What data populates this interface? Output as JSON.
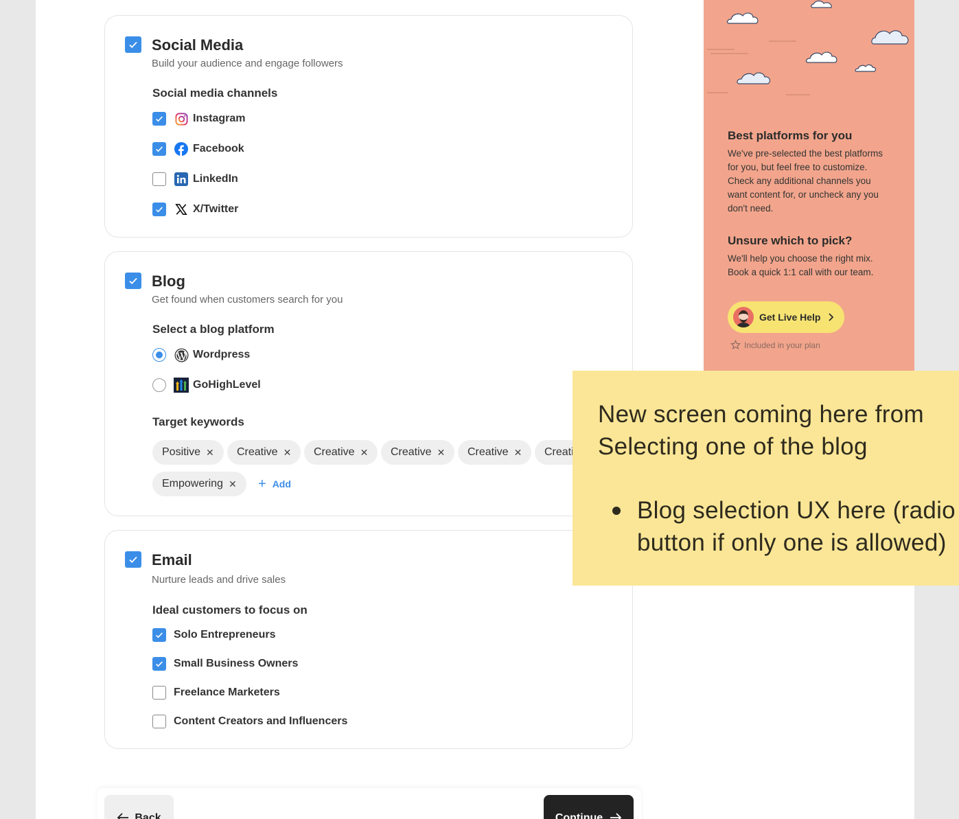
{
  "social": {
    "title": "Social Media",
    "subtitle": "Build your audience and engage followers",
    "channels_label": "Social media channels",
    "channels": [
      {
        "label": "Instagram",
        "checked": true,
        "icon": "instagram-icon"
      },
      {
        "label": "Facebook",
        "checked": true,
        "icon": "facebook-icon"
      },
      {
        "label": "LinkedIn",
        "checked": false,
        "icon": "linkedin-icon"
      },
      {
        "label": "X/Twitter",
        "checked": true,
        "icon": "x-twitter-icon"
      }
    ]
  },
  "blog": {
    "title": "Blog",
    "subtitle": "Get found when customers search for you",
    "platform_label": "Select a blog platform",
    "platforms": [
      {
        "label": "Wordpress",
        "selected": true,
        "icon": "wordpress-icon"
      },
      {
        "label": "GoHighLevel",
        "selected": false,
        "icon": "gohighlevel-icon"
      }
    ],
    "keywords_label": "Target keywords",
    "keywords": [
      "Positive",
      "Creative",
      "Creative",
      "Creative",
      "Creative",
      "Creative",
      "Empowering"
    ],
    "add_label": "Add"
  },
  "email": {
    "title": "Email",
    "subtitle": "Nurture leads and drive sales",
    "customers_label": "Ideal customers to focus on",
    "customers": [
      {
        "label": "Solo Entrepreneurs",
        "checked": true
      },
      {
        "label": "Small Business Owners",
        "checked": true
      },
      {
        "label": "Freelance Marketers",
        "checked": false
      },
      {
        "label": "Content Creators and Influencers",
        "checked": false
      }
    ]
  },
  "footer": {
    "back_label": "Back",
    "continue_label": "Continue"
  },
  "sidebar": {
    "heading1": "Best platforms for you",
    "text1": "We've pre-selected the best platforms for you, but feel free to customize. Check any additional channels you want content for, or uncheck any you don't need.",
    "heading2": "Unsure which to pick?",
    "text2": "We'll help you choose the right mix. Book a quick 1:1 call with our team.",
    "help_label": "Get Live Help",
    "included_label": "Included in your plan"
  },
  "sticky_note": {
    "title": "New screen coming here from\nSelecting one of the blog",
    "bullet": "Blog selection UX here (radio\nbutton if only one is allowed)"
  },
  "colors": {
    "accent": "#3b8ee8",
    "sidebar_bg": "#f2a58c",
    "sticky_bg": "#fae696",
    "help_button_bg": "#f7e372"
  }
}
